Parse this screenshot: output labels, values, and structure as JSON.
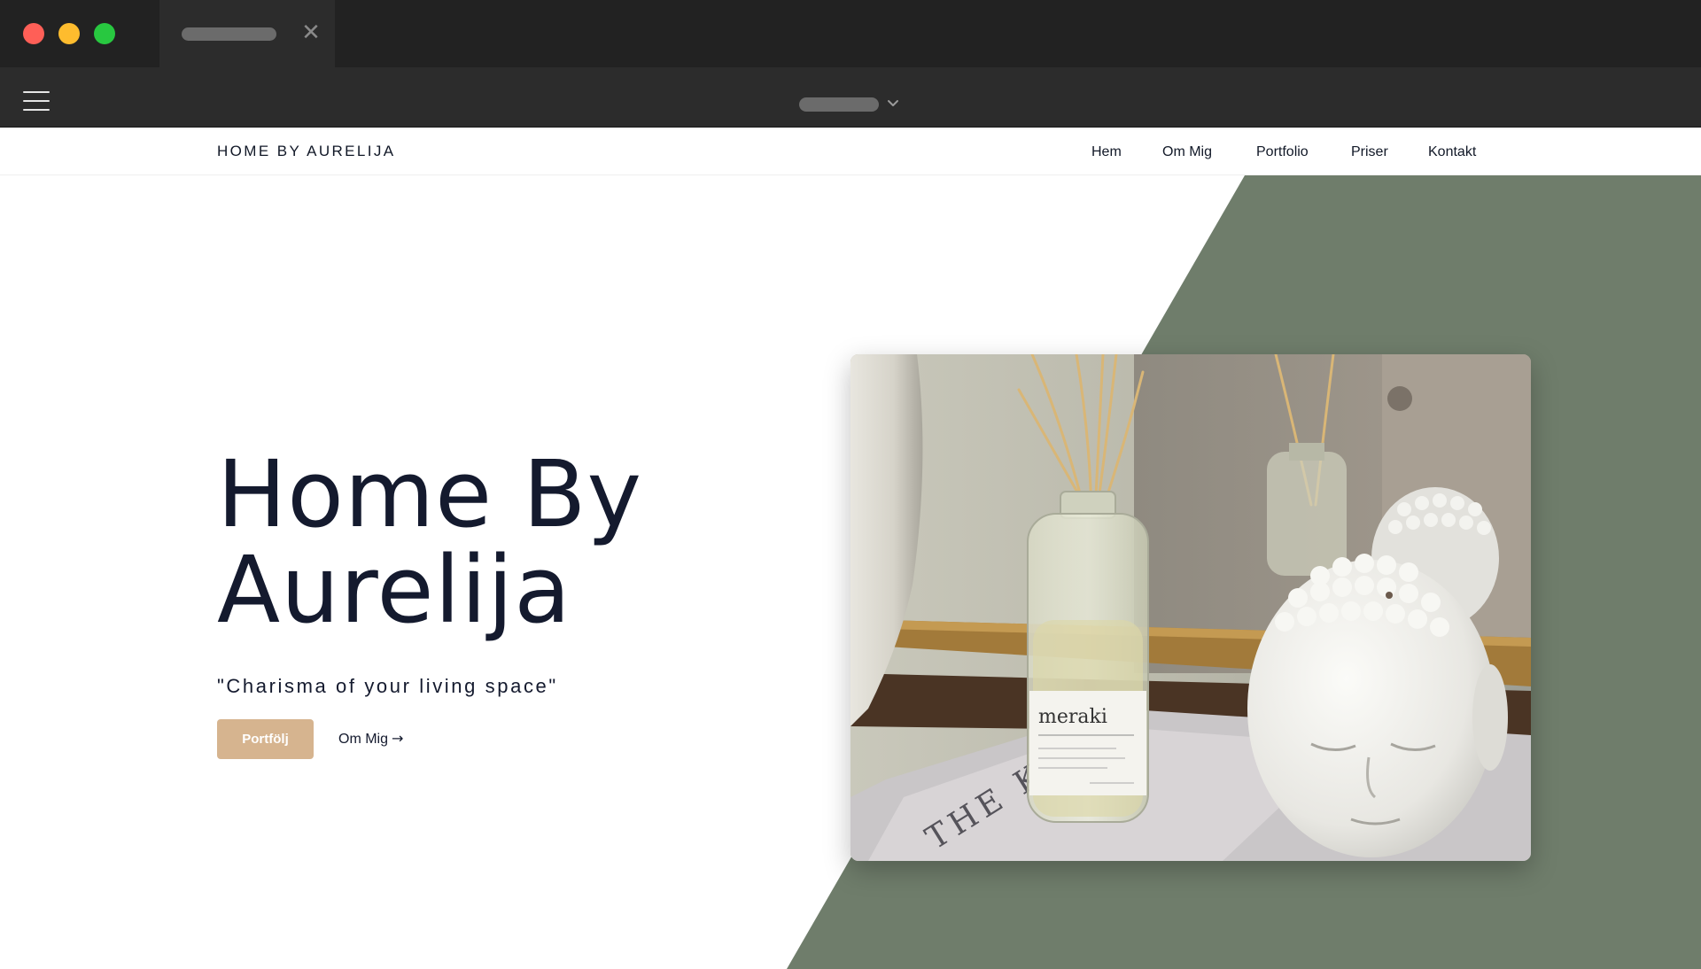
{
  "browser": {
    "colors": {
      "titlebar": "#222222",
      "toolbar": "#2c2c2c",
      "traffic_red": "#ff5f57",
      "traffic_yellow": "#febc2e",
      "traffic_green": "#28c840"
    },
    "tab_close_glyph": "✕",
    "icons": [
      "close-icon",
      "hamburger-menu-icon",
      "chevron-down-icon"
    ]
  },
  "site": {
    "brand": "HOME BY AURELIJA",
    "nav": [
      "Hem",
      "Om Mig",
      "Portfolio",
      "Priser",
      "Kontakt"
    ],
    "hero": {
      "title_line1": "Home By",
      "title_line2": "Aurelija",
      "tagline": "\"Charisma of your living space\"",
      "primary_button": "Portfölj",
      "secondary_link": "Om Mig",
      "secondary_arrow": "→"
    },
    "photo": {
      "bottle_label_brand": "meraki",
      "magazine_text": "THE KINFO"
    },
    "colors": {
      "accent_green": "#6f7d6b",
      "button_tan": "#d6b48f",
      "text_dark": "#141a2e"
    }
  }
}
